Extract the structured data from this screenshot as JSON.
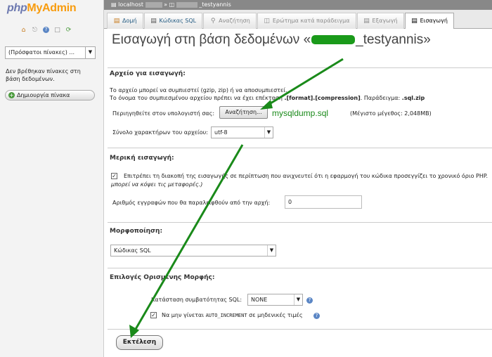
{
  "sidebar": {
    "logo_php": "php",
    "logo_myadmin": "MyAdmin",
    "icons": [
      "home-icon",
      "exit-icon",
      "help-icon",
      "docs-icon",
      "settings-icon"
    ],
    "recent_tables": "(Πρόσφατοι πίνακες) ...",
    "no_tables": "Δεν βρέθηκαν πίνακες στη βάση δεδομένων.",
    "create_table": "Δημιουργία πίνακα"
  },
  "breadcrumb": {
    "server": "localhost",
    "database": "_testyannis"
  },
  "tabs": [
    {
      "label": "Δομή",
      "icon": "structure-icon"
    },
    {
      "label": "Κώδικας SQL",
      "icon": "sql-icon"
    },
    {
      "label": "Αναζήτηση",
      "icon": "search-icon"
    },
    {
      "label": "Ερώτημα κατά παράδειγμα",
      "icon": "query-icon"
    },
    {
      "label": "Εξαγωγή",
      "icon": "export-icon"
    },
    {
      "label": "Εισαγωγή",
      "icon": "import-icon"
    }
  ],
  "title": {
    "prefix": "Εισαγωγή στη βάση δεδομένων «",
    "suffix": "_testyannis»"
  },
  "file_section": {
    "heading": "Αρχείο για εισαγωγή:",
    "line1": "Το αρχείο μπορεί να συμπιεστεί (gzip, zip) ή να αποσυμπιεστεί.",
    "line2_a": "Το όνομα του συμπιεσμένου αρχείου πρέπει να έχει επέκταση",
    "line2_b": ".[format].[compression]",
    "line2_c": ". Παράδειγμα:",
    "line2_d": ".sql.zip",
    "browse_label": "Περιηγηθείτε στον υπολογιστή σας:",
    "browse_button": "Αναζήτηση...",
    "file_name": "mysqldump.sql",
    "max_size": "(Μέγιστο μέγεθος: 2,048MB)",
    "charset_label": "Σύνολο χαρακτήρων του αρχείου:",
    "charset_value": "utf-8"
  },
  "partial_section": {
    "heading": "Μερική εισαγωγή:",
    "allow_interrupt_line1": "Επιτρέπει τη διακοπή της εισαγωγής σε περίπτωση που ανιχνευτεί ότι η εφαρμογή του κώδικα προσεγγίζει το χρονικό όριο PHP.",
    "allow_interrupt_line2": "μπορεί να κόψει τις μεταφορές.)",
    "allow_interrupt_checked": true,
    "skip_label": "Αριθμός εγγραφών που θα παραλειφθούν από την αρχή:",
    "skip_value": "0"
  },
  "format_section": {
    "heading": "Μορφοποίηση:",
    "format_value": "Κώδικας SQL"
  },
  "options_section": {
    "heading": "Επιλογές Ορισμένης Μορφής:",
    "compat_label": "Κατάσταση συμβατότητας SQL:",
    "compat_value": "NONE",
    "auto_inc_a": "Να μην γίνεται",
    "auto_inc_code": "AUTO_INCREMENT",
    "auto_inc_b": "σε μηδενικές τιμές",
    "auto_inc_checked": true
  },
  "go_button": "Εκτέλεση",
  "colors": {
    "annotation_green": "#1a8a1a",
    "logo_blue": "#6c78af",
    "logo_orange": "#f89c0e"
  }
}
